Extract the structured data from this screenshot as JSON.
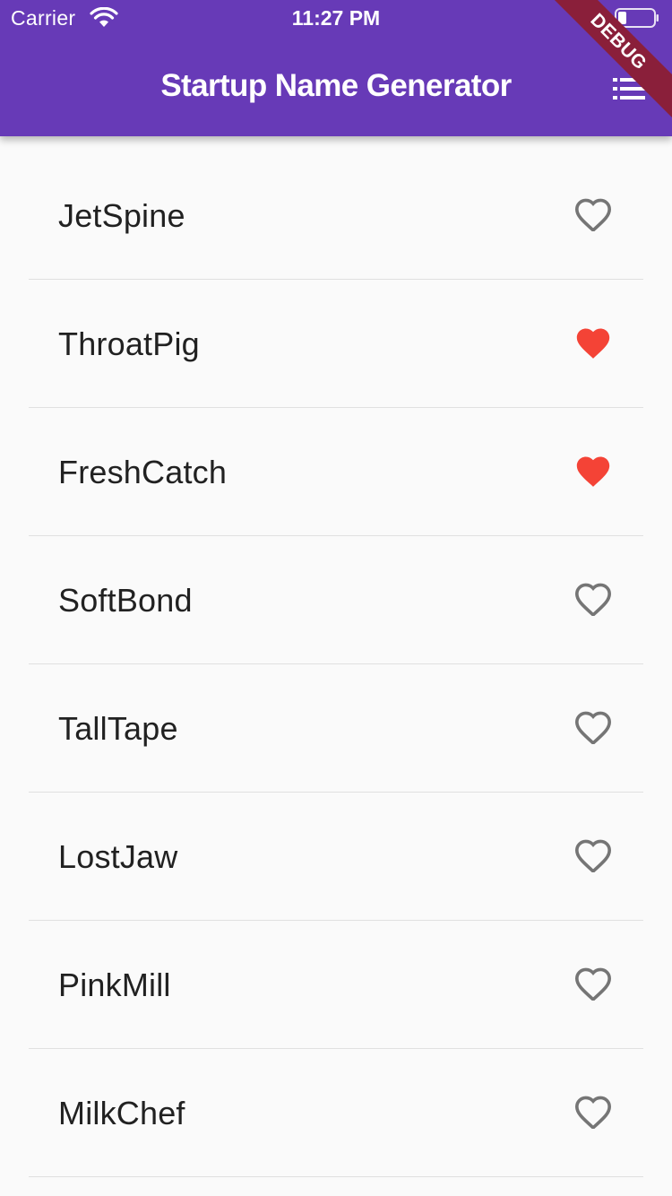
{
  "status_bar": {
    "carrier": "Carrier",
    "time": "11:27 PM",
    "wifi_icon": "wifi-icon",
    "battery_icon": "battery-icon"
  },
  "app_bar": {
    "title": "Startup Name Generator",
    "action_icon": "list-icon",
    "background_color": "#673ab7"
  },
  "debug_banner": "DEBUG",
  "colors": {
    "favorite": "#f44336",
    "not_favorite": "#757575"
  },
  "items": [
    {
      "name": "JetSpine",
      "saved": false
    },
    {
      "name": "ThroatPig",
      "saved": true
    },
    {
      "name": "FreshCatch",
      "saved": true
    },
    {
      "name": "SoftBond",
      "saved": false
    },
    {
      "name": "TallTape",
      "saved": false
    },
    {
      "name": "LostJaw",
      "saved": false
    },
    {
      "name": "PinkMill",
      "saved": false
    },
    {
      "name": "MilkChef",
      "saved": false
    }
  ]
}
